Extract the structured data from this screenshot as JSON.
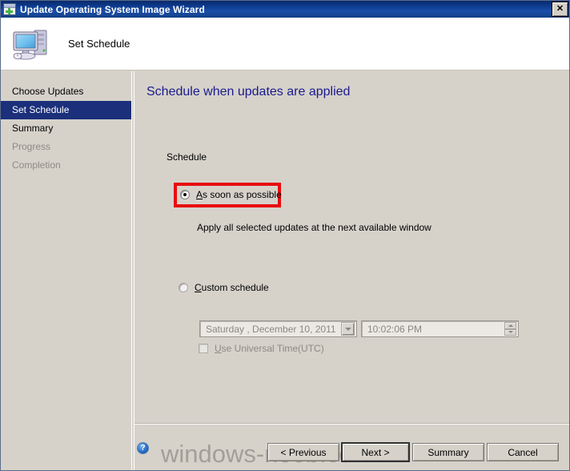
{
  "window": {
    "title": "Update Operating System Image Wizard",
    "icon": "window-plus-icon",
    "close_label": "✕"
  },
  "header": {
    "title": "Set Schedule",
    "icon": "computer-icon"
  },
  "sidebar": {
    "items": [
      {
        "label": "Choose Updates",
        "state": "normal"
      },
      {
        "label": "Set Schedule",
        "state": "active"
      },
      {
        "label": "Summary",
        "state": "normal"
      },
      {
        "label": "Progress",
        "state": "disabled"
      },
      {
        "label": "Completion",
        "state": "disabled"
      }
    ]
  },
  "main": {
    "heading": "Schedule when updates are applied",
    "group_label": "Schedule",
    "option_asap": {
      "accel": "A",
      "label_rest": "s soon as possible",
      "checked": true,
      "highlighted": true
    },
    "asap_hint": "Apply all selected updates at the next available window",
    "option_custom": {
      "accel": "C",
      "label_rest": "ustom schedule",
      "checked": false
    },
    "date_field": {
      "value": "Saturday   ,  December 10, 2011",
      "enabled": false,
      "dropdown_icon": "chevron-down-icon"
    },
    "time_field": {
      "value": "10:02:06 PM",
      "enabled": false,
      "spinner_icon": "spinner-updown-icon"
    },
    "checkbox_utc": {
      "accel": "U",
      "label_rest": "se Universal Time(UTC)",
      "checked": false,
      "enabled": false
    }
  },
  "footer": {
    "help_icon": "help-question-icon",
    "help_glyph": "?",
    "buttons": {
      "previous": "< Previous",
      "next": "Next >",
      "summary": "Summary",
      "cancel": "Cancel"
    }
  },
  "watermark": "windows-noob.com",
  "colors": {
    "titlebar": "#0d3a8c",
    "heading": "#1a1a8c",
    "sidebar_active": "#1b2f7a",
    "annotation_red": "#e80d0d",
    "dialog_face": "#d6d2ca"
  }
}
